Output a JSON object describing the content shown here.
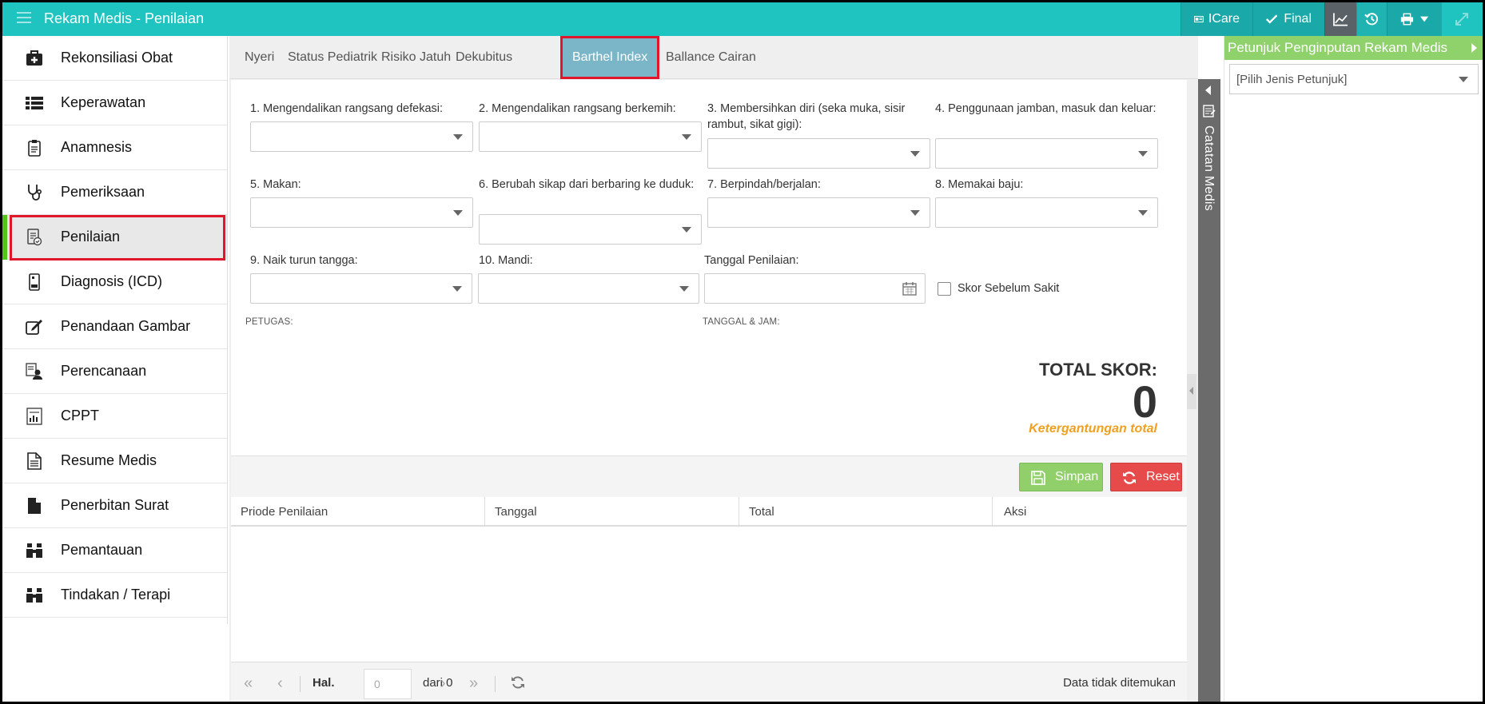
{
  "titlebar": {
    "title": "Rekam Medis - Penilaian",
    "icare_label": "ICare",
    "final_label": "Final"
  },
  "sidebar": {
    "items": [
      {
        "label": "Rekonsiliasi Obat",
        "icon": "medkit-icon"
      },
      {
        "label": "Keperawatan",
        "icon": "list-icon"
      },
      {
        "label": "Anamnesis",
        "icon": "clipboard-icon"
      },
      {
        "label": "Pemeriksaan",
        "icon": "stethoscope-icon"
      },
      {
        "label": "Penilaian",
        "icon": "assessment-icon",
        "active": true
      },
      {
        "label": "Diagnosis (ICD)",
        "icon": "mobile-doc-icon"
      },
      {
        "label": "Penandaan Gambar",
        "icon": "edit-icon"
      },
      {
        "label": "Perencanaan",
        "icon": "plan-user-icon"
      },
      {
        "label": "CPPT",
        "icon": "chart-doc-icon"
      },
      {
        "label": "Resume Medis",
        "icon": "file-text-icon"
      },
      {
        "label": "Penerbitan Surat",
        "icon": "file-icon"
      },
      {
        "label": "Pemantauan",
        "icon": "binoculars-icon"
      },
      {
        "label": "Tindakan / Terapi",
        "icon": "binoculars-icon"
      }
    ]
  },
  "tabs": [
    {
      "label": "Nyeri"
    },
    {
      "label": "Status Pediatrik"
    },
    {
      "label": "Risiko Jatuh"
    },
    {
      "label": "Dekubitus"
    },
    {
      "label": "Barthel Index",
      "active": true
    },
    {
      "label": "Ballance Cairan"
    }
  ],
  "form": {
    "q1": "1. Mengendalikan rangsang defekasi:",
    "q2": "2. Mengendalikan rangsang berkemih:",
    "q3": "3. Membersihkan diri (seka muka, sisir rambut, sikat gigi):",
    "q4": "4. Penggunaan jamban, masuk dan keluar:",
    "q5": "5. Makan:",
    "q6": "6. Berubah sikap dari berbaring ke duduk:",
    "q7": "7. Berpindah/berjalan:",
    "q8": "8. Memakai baju:",
    "q9": "9. Naik turun tangga:",
    "q10": "10. Mandi:",
    "tanggal_label": "Tanggal Penilaian:",
    "skor_sebelum_sakit": "Skor Sebelum Sakit",
    "petugas_label": "PETUGAS:",
    "tanggal_jam_label": "TANGGAL & JAM:",
    "total_label": "TOTAL SKOR:",
    "total_value": "0",
    "total_category": "Ketergantungan total",
    "category_color": "#f0a020"
  },
  "actions": {
    "save_label": "Simpan",
    "reset_label": "Reset"
  },
  "grid": {
    "columns": [
      "Priode Penilaian",
      "Tanggal",
      "Total",
      "Aksi"
    ],
    "rows": []
  },
  "pager": {
    "hal_label": "Hal.",
    "page_value": "0",
    "of_label": "dari 0",
    "status": "Data tidak ditemukan"
  },
  "catatan": {
    "label": "Catatan Medis"
  },
  "rightpanel": {
    "title": "Petunjuk Penginputan Rekam Medis",
    "select_value": "[Pilih Jenis Petunjuk]"
  },
  "colors": {
    "titlebar": "#1fc4c0",
    "accent_green": "#8fd16a",
    "reset_red": "#e64a4a",
    "highlight_red": "#e0172a"
  }
}
